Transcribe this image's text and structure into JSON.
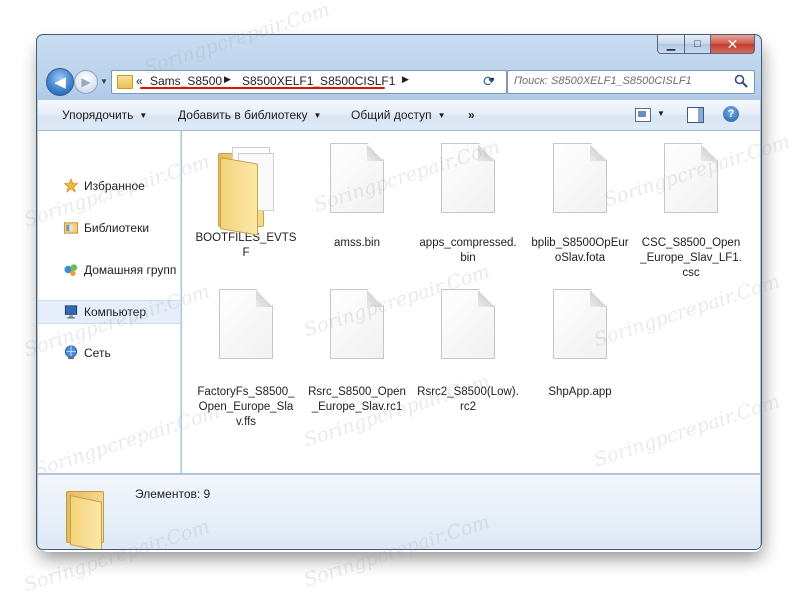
{
  "window": {
    "caption": {
      "minimize": "▁",
      "maximize": "□",
      "close": "✕"
    },
    "icons": {
      "back": "back-arrow-icon",
      "forward": "forward-arrow-icon",
      "refresh": "refresh-icon",
      "search": "search-icon"
    }
  },
  "address": {
    "prefix": "«",
    "crumbs": [
      "Sams_S8500",
      "S8500XELF1_S8500CISLF1"
    ],
    "highlight_color": "#d9140d"
  },
  "search": {
    "placeholder": "Поиск: S8500XELF1_S8500CISLF1"
  },
  "toolbar": {
    "organize": "Упорядочить",
    "add_to_library": "Добавить в библиотеку",
    "share": "Общий доступ",
    "more": "»"
  },
  "sidebar": {
    "items": [
      {
        "label": "Избранное",
        "icon": "star-icon"
      },
      {
        "label": "Библиотеки",
        "icon": "libraries-icon"
      },
      {
        "label": "Домашняя групп",
        "icon": "homegroup-icon"
      },
      {
        "label": "Компьютер",
        "icon": "computer-icon"
      },
      {
        "label": "Сеть",
        "icon": "network-icon"
      }
    ]
  },
  "files": [
    {
      "name": "BOOTFILES_EVTSF",
      "type": "folder"
    },
    {
      "name": "amss.bin",
      "type": "file"
    },
    {
      "name": "apps_compressed.bin",
      "type": "file"
    },
    {
      "name": "bplib_S8500OpEuroSlav.fota",
      "type": "file"
    },
    {
      "name": "CSC_S8500_Open_Europe_Slav_LF1.csc",
      "type": "file"
    },
    {
      "name": "FactoryFs_S8500_Open_Europe_Slav.ffs",
      "type": "file"
    },
    {
      "name": "Rsrc_S8500_Open_Europe_Slav.rc1",
      "type": "file"
    },
    {
      "name": "Rsrc2_S8500(Low).rc2",
      "type": "file"
    },
    {
      "name": "ShpApp.app",
      "type": "file"
    }
  ],
  "status": {
    "items_count": "Элементов: 9"
  },
  "watermark": "Soringpcrepair.Com"
}
